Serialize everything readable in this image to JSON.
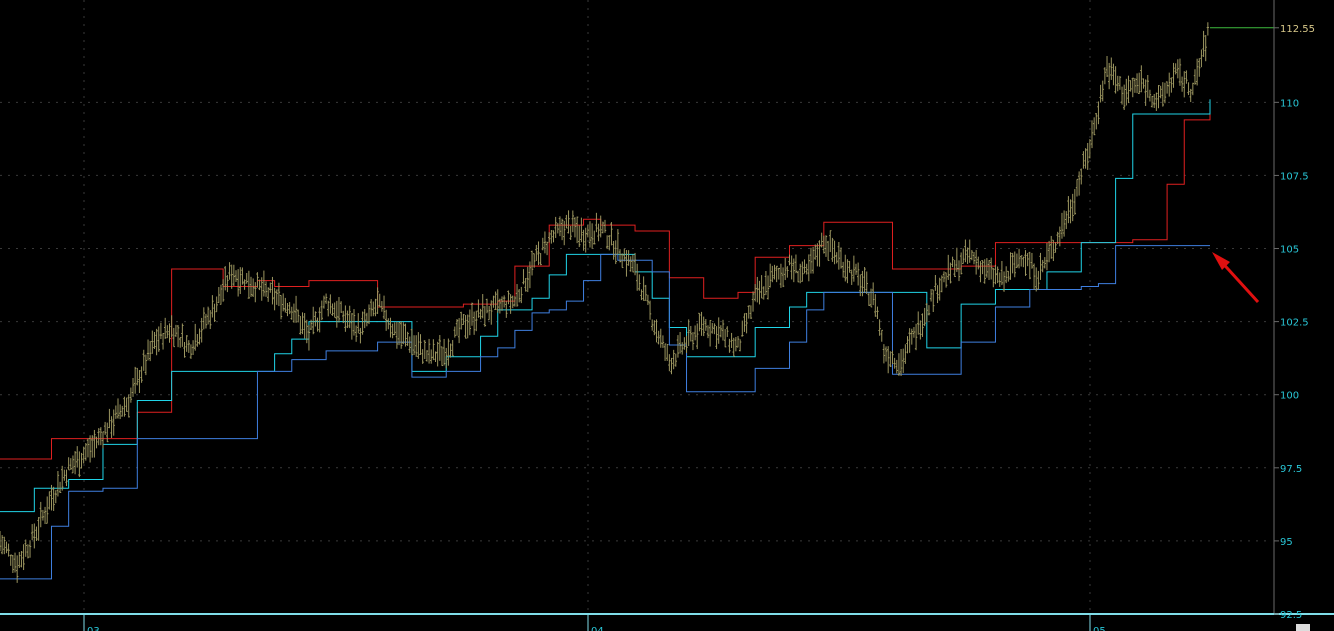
{
  "chart_data": {
    "type": "candlestick",
    "grid": true,
    "y_axis": {
      "min": 92.5,
      "max": 113.5,
      "side": "right",
      "ticks": [
        "92.5",
        "95",
        "97.5",
        "100",
        "102.5",
        "105",
        "107.5",
        "110",
        "112.55"
      ]
    },
    "last_price": "112.55",
    "x_axis": {
      "month_labels": [
        "03",
        "04",
        "05"
      ]
    },
    "series": [
      {
        "kind": "price",
        "knots": [
          [
            0,
            95
          ],
          [
            2,
            94.2
          ],
          [
            4,
            95.2
          ],
          [
            6,
            96.5
          ],
          [
            8,
            97.5
          ],
          [
            11,
            98.3
          ],
          [
            15,
            99.8
          ],
          [
            18,
            101.8
          ],
          [
            20,
            102.3
          ],
          [
            22,
            101.6
          ],
          [
            25,
            103
          ],
          [
            27,
            104.2
          ],
          [
            30,
            103.7
          ],
          [
            34,
            103
          ],
          [
            36,
            102
          ],
          [
            38,
            103.2
          ],
          [
            40,
            102.7
          ],
          [
            42,
            102.2
          ],
          [
            44,
            103.1
          ],
          [
            46,
            102.2
          ],
          [
            48,
            101.8
          ],
          [
            50,
            101.3
          ],
          [
            52,
            101.5
          ],
          [
            54,
            102.4
          ],
          [
            56,
            102.8
          ],
          [
            58,
            103
          ],
          [
            60,
            103.2
          ],
          [
            62,
            104.4
          ],
          [
            64,
            105.3
          ],
          [
            66,
            105.8
          ],
          [
            68,
            105.5
          ],
          [
            70,
            105.7
          ],
          [
            72,
            105
          ],
          [
            74,
            104.3
          ],
          [
            76,
            102.6
          ],
          [
            78,
            101.1
          ],
          [
            80,
            101.8
          ],
          [
            82,
            102.4
          ],
          [
            84,
            102.1
          ],
          [
            86,
            101.6
          ],
          [
            88,
            103.3
          ],
          [
            90,
            104
          ],
          [
            92,
            104.4
          ],
          [
            94,
            104.1
          ],
          [
            96,
            105.3
          ],
          [
            98,
            104.6
          ],
          [
            100,
            104
          ],
          [
            102,
            103.2
          ],
          [
            103,
            101.5
          ],
          [
            105,
            101.1
          ],
          [
            107,
            102.3
          ],
          [
            109,
            103.6
          ],
          [
            111,
            104.3
          ],
          [
            113,
            104.8
          ],
          [
            115,
            104.2
          ],
          [
            117,
            103.9
          ],
          [
            119,
            104.8
          ],
          [
            121,
            104.1
          ],
          [
            123,
            105.2
          ],
          [
            125,
            106.6
          ],
          [
            127,
            108.5
          ],
          [
            129,
            111.2
          ],
          [
            131,
            110.3
          ],
          [
            133,
            110.7
          ],
          [
            135,
            110
          ],
          [
            137,
            111
          ],
          [
            139,
            110.4
          ],
          [
            140,
            111.5
          ],
          [
            141,
            112.6
          ]
        ]
      },
      {
        "kind": "upper",
        "color": "#e02020",
        "steps": [
          [
            0,
            97.8
          ],
          [
            6,
            98.5
          ],
          [
            12,
            98.5
          ],
          [
            16,
            99.4
          ],
          [
            20,
            104.3
          ],
          [
            26,
            103.7
          ],
          [
            30,
            103.9
          ],
          [
            32,
            103.7
          ],
          [
            36,
            103.9
          ],
          [
            44,
            103
          ],
          [
            50,
            103
          ],
          [
            54,
            103.1
          ],
          [
            58,
            103.2
          ],
          [
            60,
            104.4
          ],
          [
            64,
            105.8
          ],
          [
            68,
            106
          ],
          [
            70,
            105.8
          ],
          [
            74,
            105.6
          ],
          [
            78,
            104
          ],
          [
            82,
            103.3
          ],
          [
            86,
            103.5
          ],
          [
            88,
            104.7
          ],
          [
            92,
            105.1
          ],
          [
            96,
            105.9
          ],
          [
            100,
            105.9
          ],
          [
            104,
            104.3
          ],
          [
            112,
            104.4
          ],
          [
            116,
            105.2
          ],
          [
            126,
            105.2
          ],
          [
            132,
            105.3
          ],
          [
            136,
            107.2
          ],
          [
            138,
            109.4
          ],
          [
            141,
            110.1
          ]
        ]
      },
      {
        "kind": "middle",
        "color": "#20d4e8",
        "steps": [
          [
            0,
            96
          ],
          [
            4,
            96.8
          ],
          [
            8,
            97.1
          ],
          [
            12,
            98.3
          ],
          [
            16,
            99.8
          ],
          [
            20,
            100.8
          ],
          [
            26,
            100.8
          ],
          [
            32,
            101.4
          ],
          [
            34,
            101.9
          ],
          [
            36,
            102.5
          ],
          [
            44,
            102.5
          ],
          [
            48,
            100.8
          ],
          [
            52,
            101.3
          ],
          [
            56,
            102
          ],
          [
            58,
            102.9
          ],
          [
            62,
            103.3
          ],
          [
            64,
            104.1
          ],
          [
            66,
            104.8
          ],
          [
            70,
            104.8
          ],
          [
            72,
            104.8
          ],
          [
            74,
            104.2
          ],
          [
            76,
            103.3
          ],
          [
            78,
            102.3
          ],
          [
            80,
            101.3
          ],
          [
            84,
            101.3
          ],
          [
            88,
            102.3
          ],
          [
            92,
            103
          ],
          [
            94,
            103.5
          ],
          [
            104,
            103.5
          ],
          [
            108,
            101.6
          ],
          [
            112,
            103.1
          ],
          [
            116,
            103.6
          ],
          [
            122,
            104.2
          ],
          [
            126,
            105.2
          ],
          [
            130,
            107.4
          ],
          [
            132,
            109.6
          ],
          [
            141,
            110.1
          ]
        ]
      },
      {
        "kind": "lower",
        "color": "#3f7fe0",
        "steps": [
          [
            0,
            93.7
          ],
          [
            4,
            93.7
          ],
          [
            6,
            95.5
          ],
          [
            8,
            96.7
          ],
          [
            12,
            96.8
          ],
          [
            16,
            98.5
          ],
          [
            20,
            98.5
          ],
          [
            26,
            98.5
          ],
          [
            30,
            100.8
          ],
          [
            34,
            101.2
          ],
          [
            38,
            101.5
          ],
          [
            44,
            101.8
          ],
          [
            48,
            100.6
          ],
          [
            52,
            100.8
          ],
          [
            56,
            101.3
          ],
          [
            58,
            101.6
          ],
          [
            60,
            102.2
          ],
          [
            62,
            102.8
          ],
          [
            64,
            102.9
          ],
          [
            66,
            103.2
          ],
          [
            68,
            103.9
          ],
          [
            70,
            104.8
          ],
          [
            72,
            104.6
          ],
          [
            76,
            104.2
          ],
          [
            78,
            101.7
          ],
          [
            80,
            100.1
          ],
          [
            84,
            100.1
          ],
          [
            88,
            100.9
          ],
          [
            92,
            101.8
          ],
          [
            94,
            102.9
          ],
          [
            96,
            103.5
          ],
          [
            100,
            103.5
          ],
          [
            104,
            100.7
          ],
          [
            108,
            100.7
          ],
          [
            112,
            101.8
          ],
          [
            116,
            103
          ],
          [
            120,
            103.6
          ],
          [
            124,
            103.6
          ],
          [
            126,
            103.7
          ],
          [
            128,
            103.8
          ],
          [
            130,
            105.1
          ],
          [
            141,
            105.1
          ]
        ]
      }
    ]
  }
}
